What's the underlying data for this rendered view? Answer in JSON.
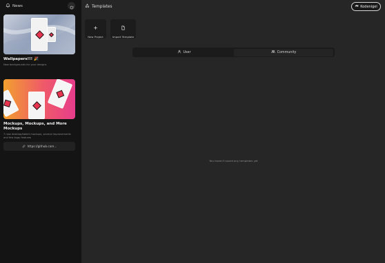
{
  "sidebar": {
    "header": {
      "title": "News",
      "icon": "bell-icon",
      "refresh_icon": "refresh-icon"
    },
    "cards": [
      {
        "title": "Wallpapers!!! 🎉",
        "description": "New backgrounds for your designs"
      },
      {
        "title": "Mockups, Mockups, and More Mockups",
        "description": "7 new desktop/tablet mockups, several improvements and few bugs features",
        "link_label": "https://github.com..."
      }
    ]
  },
  "topbar": {
    "title": "Templates",
    "kofi_label": "Kodenigel"
  },
  "actions": [
    {
      "label": "New Project",
      "icon": "plus-icon"
    },
    {
      "label": "Import Template",
      "icon": "file-icon"
    }
  ],
  "tabs": [
    {
      "label": "User",
      "icon": "user-icon"
    },
    {
      "label": "Community",
      "icon": "users-icon",
      "selected": true
    }
  ],
  "empty_state": "You haven't saved any templates yet",
  "colors": {
    "background": "#262626",
    "sidebar": "#141414",
    "accent_pink": "#e8344e"
  }
}
